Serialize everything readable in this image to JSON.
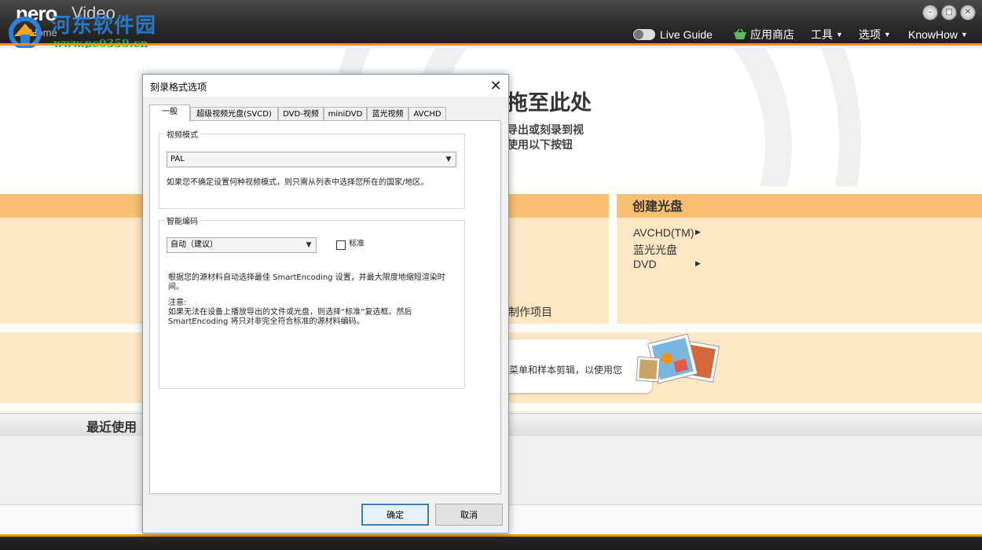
{
  "app": {
    "logo": "nero",
    "product": "Video",
    "home_label": "Home",
    "watermark_title": "河东软件园",
    "watermark_url": "www.pc0359.cn",
    "accent_color": "#f29400"
  },
  "top_menu": {
    "live_guide": "Live Guide",
    "app_store": "应用商店",
    "tools": "工具",
    "options": "选项",
    "knowhow": "KnowHow"
  },
  "hero": {
    "title": "拖至此处",
    "line1": "导出或刻录到视",
    "line2": "使用以下按钮"
  },
  "create_disc": {
    "header": "创建光盘",
    "items": [
      "AVCHD(TM)",
      "蓝光光盘",
      "DVD"
    ]
  },
  "left_panel": {
    "link": "制作项目"
  },
  "promo": {
    "text": "菜单和样本剪辑，以使用您"
  },
  "recent": {
    "title": "最近使用"
  },
  "dialog": {
    "title": "刻录格式选项",
    "tabs": [
      "一般",
      "超级视频光盘(SVCD)",
      "DVD-视频",
      "miniDVD",
      "蓝光视频",
      "AVCHD"
    ],
    "active_tab": "一般",
    "video_mode": {
      "label": "视频模式",
      "value": "PAL",
      "hint": "如果您不确定设置何种视频模式，则只需从列表中选择您所在的国家/地区。"
    },
    "smart_encoding": {
      "label": "智能编码",
      "value": "自动（建议）",
      "checkbox_label": "标准",
      "checkbox_checked": false,
      "desc": "根据您的源材料自动选择最佳 SmartEncoding 设置，并最大限度地缩短渲染时间。",
      "note_title": "注意:",
      "note": "如果无法在设备上播放导出的文件或光盘，则选择“标准”复选框。然后 SmartEncoding 将只对非完全符合标准的源材料编码。"
    },
    "ok": "确定",
    "cancel": "取消"
  }
}
